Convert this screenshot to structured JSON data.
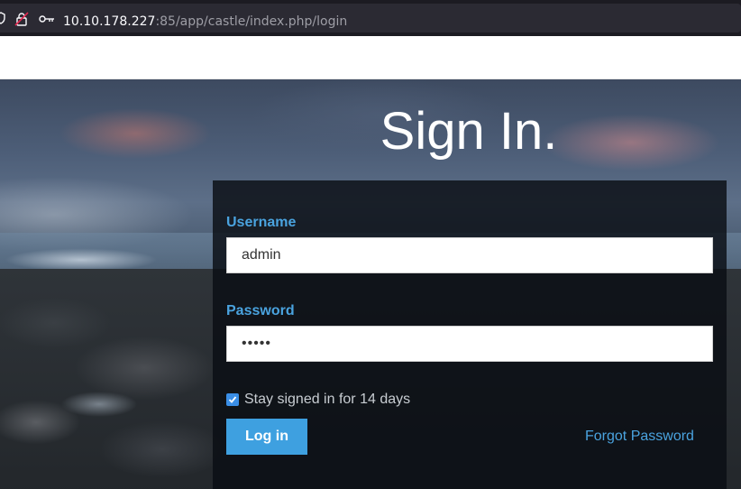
{
  "browser": {
    "url_host": "10.10.178.227",
    "url_rest": ":85/app/castle/index.php/login"
  },
  "login": {
    "title": "Sign In.",
    "username_label": "Username",
    "username_value": "admin",
    "password_label": "Password",
    "password_value": "•••••",
    "remember_checked": true,
    "remember_label": "Stay signed in for 14 days",
    "login_button": "Log in",
    "forgot_link": "Forgot Password"
  },
  "colors": {
    "accent": "#4aa3df",
    "button": "#3ea0e0",
    "card_bg": "#0a0e14"
  }
}
